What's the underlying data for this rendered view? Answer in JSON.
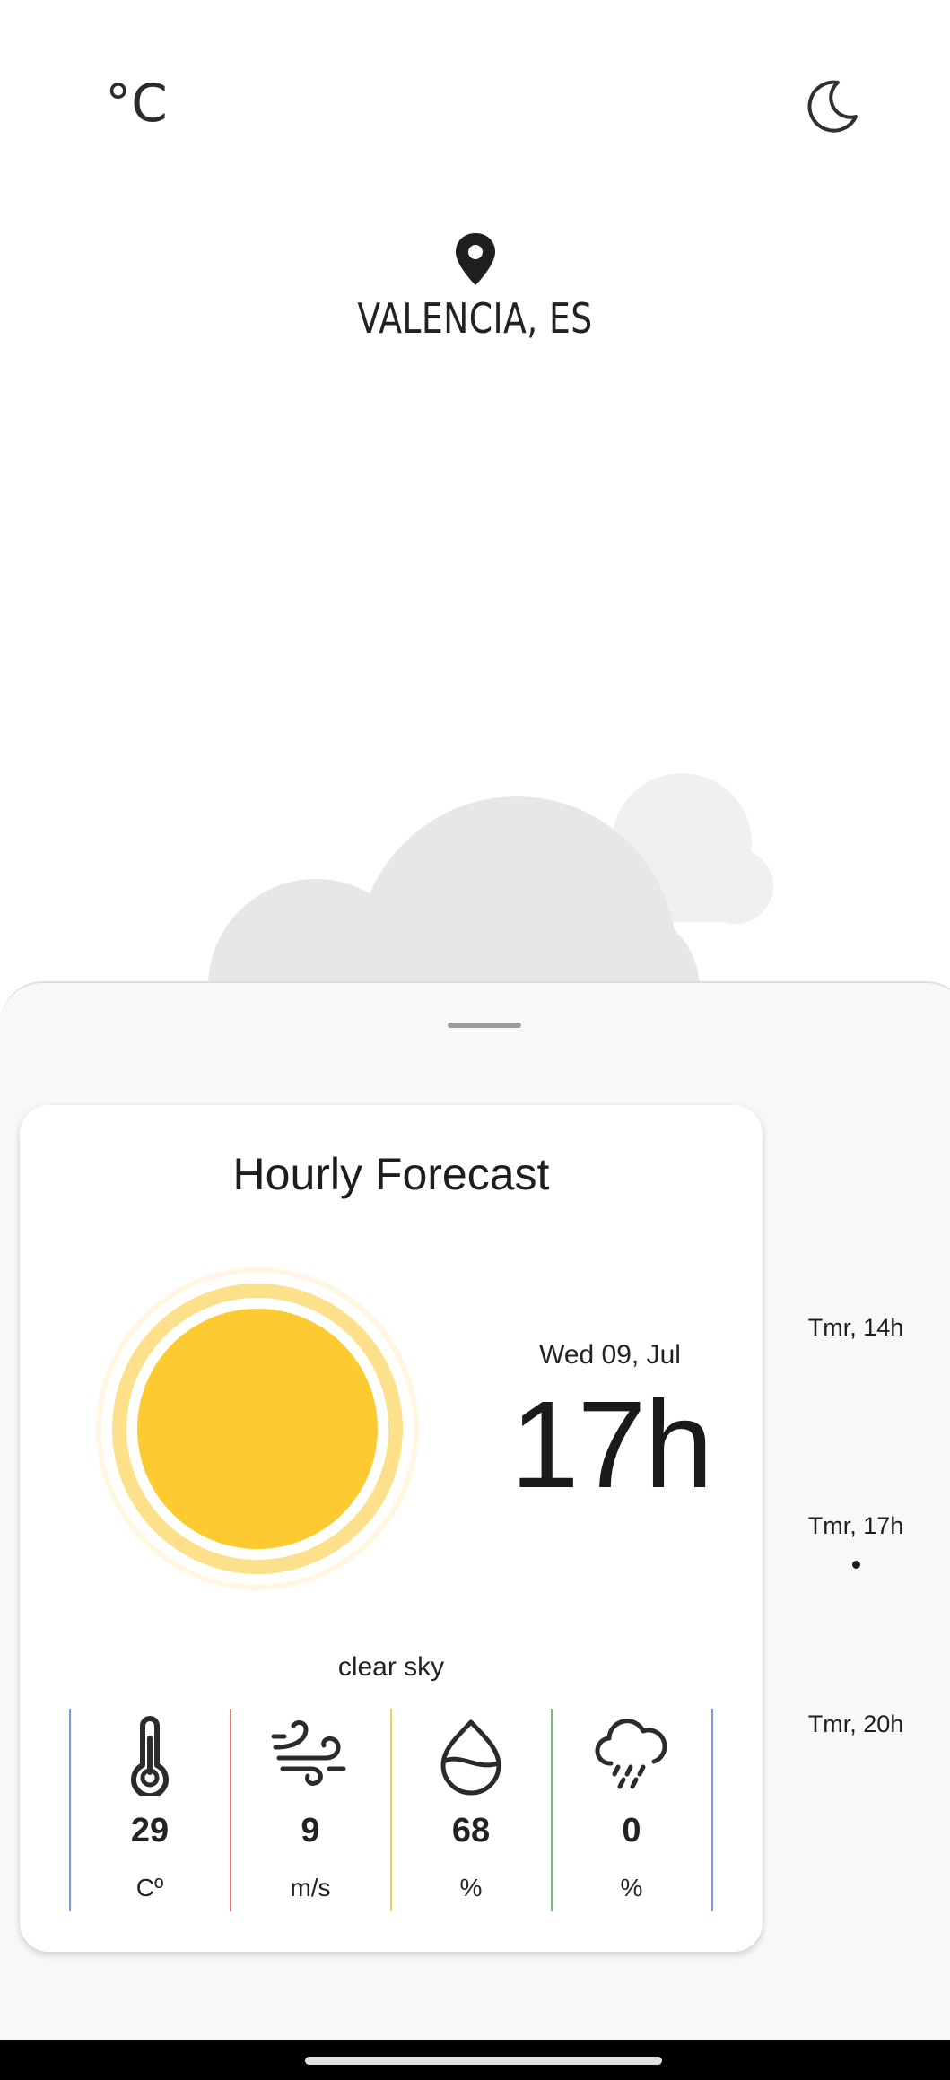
{
  "header": {
    "unit_toggle": "°C",
    "theme_icon": "moon-icon",
    "location_icon": "map-pin-icon",
    "location": "VALENCIA, ES"
  },
  "background": {
    "icon": "cloud-icon"
  },
  "forecast_card": {
    "title": "Hourly Forecast",
    "weather_icon": "sun-icon",
    "date": "Wed 09, Jul",
    "hour": "17h",
    "condition": "clear sky",
    "metrics": [
      {
        "icon": "thermometer-icon",
        "value": "29",
        "unit": "Cº",
        "color": "#7b9be0"
      },
      {
        "icon": "wind-icon",
        "value": "9",
        "unit": "m/s",
        "color": "#e07b7b"
      },
      {
        "icon": "humidity-drop-icon",
        "value": "68",
        "unit": "%",
        "color": "#e7d25a"
      },
      {
        "icon": "rain-cloud-icon",
        "value": "0",
        "unit": "%",
        "color": "#6fbf7f"
      }
    ],
    "end_divider_color": "#7b9be0"
  },
  "side_hours": [
    {
      "label": "Tmr, 14h"
    },
    {
      "label": "Tmr, 17h",
      "selected": true
    },
    {
      "label": "Tmr, 20h"
    }
  ],
  "colors": {
    "sun": "#fdca31",
    "sun_ring": "#fde08a",
    "sheet_background": "#f7f8fa",
    "cloud": "#e8e8e8"
  }
}
